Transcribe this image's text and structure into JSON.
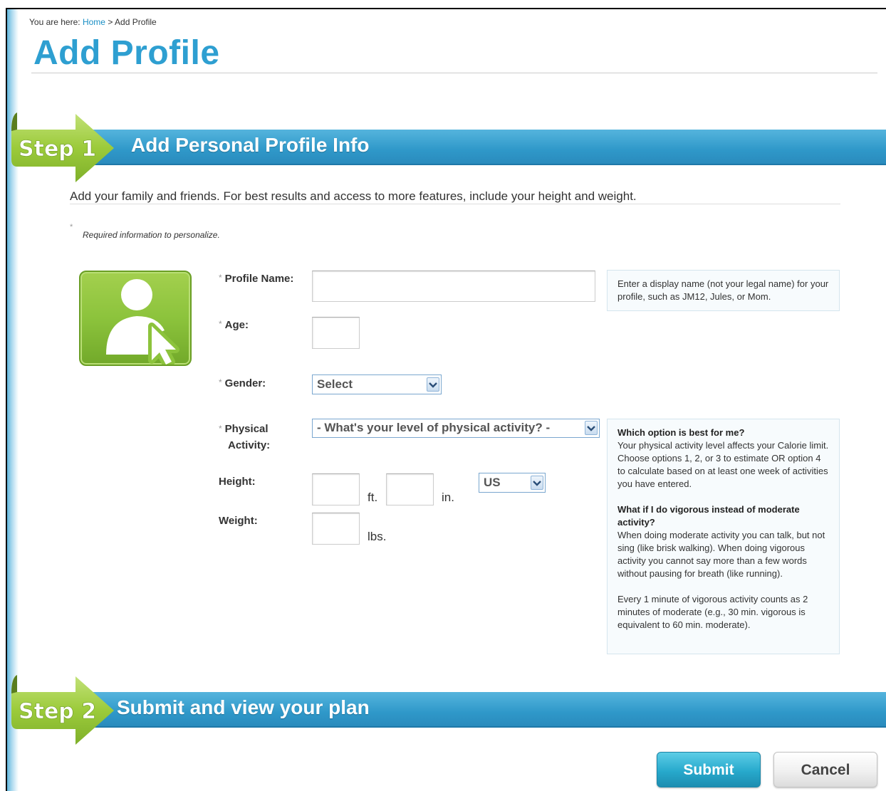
{
  "breadcrumb": {
    "prefix": "You are here:",
    "home": "Home",
    "separator": ">",
    "current": "Add Profile"
  },
  "page_title": "Add Profile",
  "step1": {
    "badge": "Step 1",
    "heading": "Add Personal Profile Info"
  },
  "intro": "Add your family and friends. For best results and access to more features, include your height and weight.",
  "required": {
    "star": "*",
    "note": "Required information to personalize."
  },
  "form": {
    "required_star": "*",
    "profile_name": {
      "label": "Profile Name:",
      "value": "",
      "tip": "Enter a display name (not your legal name) for your profile, such as JM12, Jules, or Mom."
    },
    "age": {
      "label": "Age:",
      "value": ""
    },
    "gender": {
      "label": "Gender:",
      "selected": "Select"
    },
    "activity": {
      "label_line1": "Physical",
      "label_line2": "Activity:",
      "selected": "- What's your level of physical activity? -"
    },
    "height": {
      "label": "Height:",
      "feet": "",
      "inches": "",
      "ft_unit": "ft.",
      "in_unit": "in.",
      "system": "US"
    },
    "weight": {
      "label": "Weight:",
      "value": "",
      "unit": "lbs."
    }
  },
  "activity_help": {
    "q1": "Which option is best for me?",
    "a1": "Your physical activity level affects your Calorie limit. Choose options 1, 2, or 3 to estimate OR option 4 to calculate based on at least one week of activities you have entered.",
    "q2": "What if I do vigorous instead of moderate activity?",
    "a2": "When doing moderate activity you can talk, but not sing (like brisk walking). When doing vigorous activity you cannot say more than a few words without pausing for breath (like running).",
    "a3": "Every 1 minute of vigorous activity counts as 2 minutes of moderate (e.g., 30 min. vigorous is equivalent to 60 min. moderate)."
  },
  "step2": {
    "badge": "Step 2",
    "heading": "Submit and view your plan"
  },
  "buttons": {
    "submit": "Submit",
    "cancel": "Cancel"
  },
  "colors": {
    "accent_blue": "#2e9fd1",
    "step_green": "#9ccb3b",
    "link": "#1a8fc5"
  }
}
